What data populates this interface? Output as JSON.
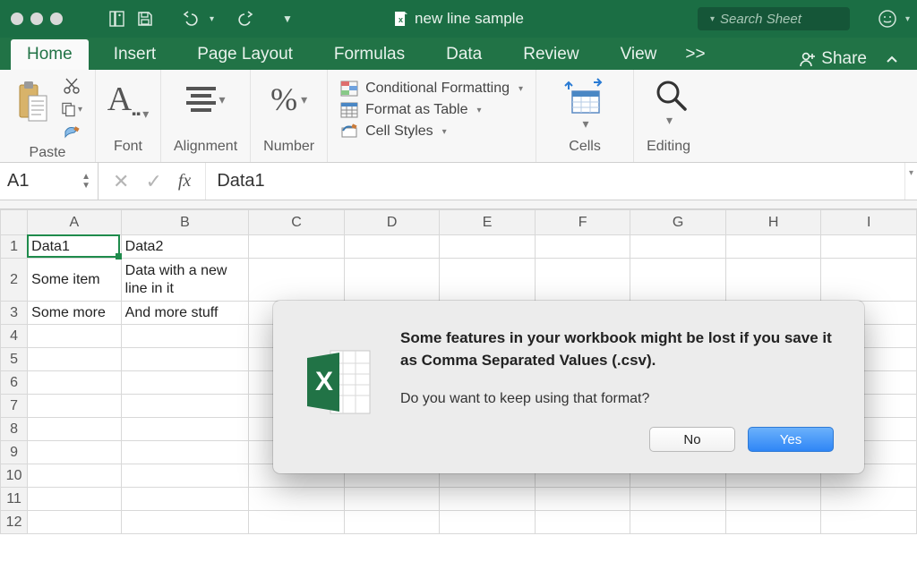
{
  "titlebar": {
    "document_name": "new line sample",
    "search_placeholder": "Search Sheet"
  },
  "tabs": [
    "Home",
    "Insert",
    "Page Layout",
    "Formulas",
    "Data",
    "Review",
    "View"
  ],
  "active_tab": "Home",
  "share_label": "Share",
  "ribbon": {
    "paste": "Paste",
    "font": "Font",
    "alignment": "Alignment",
    "number": "Number",
    "conditional_formatting": "Conditional Formatting",
    "format_as_table": "Format as Table",
    "cell_styles": "Cell Styles",
    "cells": "Cells",
    "editing": "Editing"
  },
  "formula_bar": {
    "cell_ref": "A1",
    "fx": "fx",
    "formula_value": "Data1"
  },
  "sheet": {
    "columns": [
      "A",
      "B",
      "C",
      "D",
      "E",
      "F",
      "G",
      "H",
      "I"
    ],
    "rows": [
      {
        "n": "1",
        "A": "Data1",
        "B": "Data2"
      },
      {
        "n": "2",
        "A": "Some item",
        "B": "Data with a new line in it"
      },
      {
        "n": "3",
        "A": "Some more",
        "B": "And more stuff"
      },
      {
        "n": "4"
      },
      {
        "n": "5"
      },
      {
        "n": "6"
      },
      {
        "n": "7"
      },
      {
        "n": "8"
      },
      {
        "n": "9"
      },
      {
        "n": "10"
      },
      {
        "n": "11"
      },
      {
        "n": "12"
      }
    ],
    "active": "A1"
  },
  "dialog": {
    "title": "Some features in your workbook might be lost if you save it as Comma Separated Values (.csv).",
    "message": "Do you want to keep using that format?",
    "no": "No",
    "yes": "Yes"
  }
}
